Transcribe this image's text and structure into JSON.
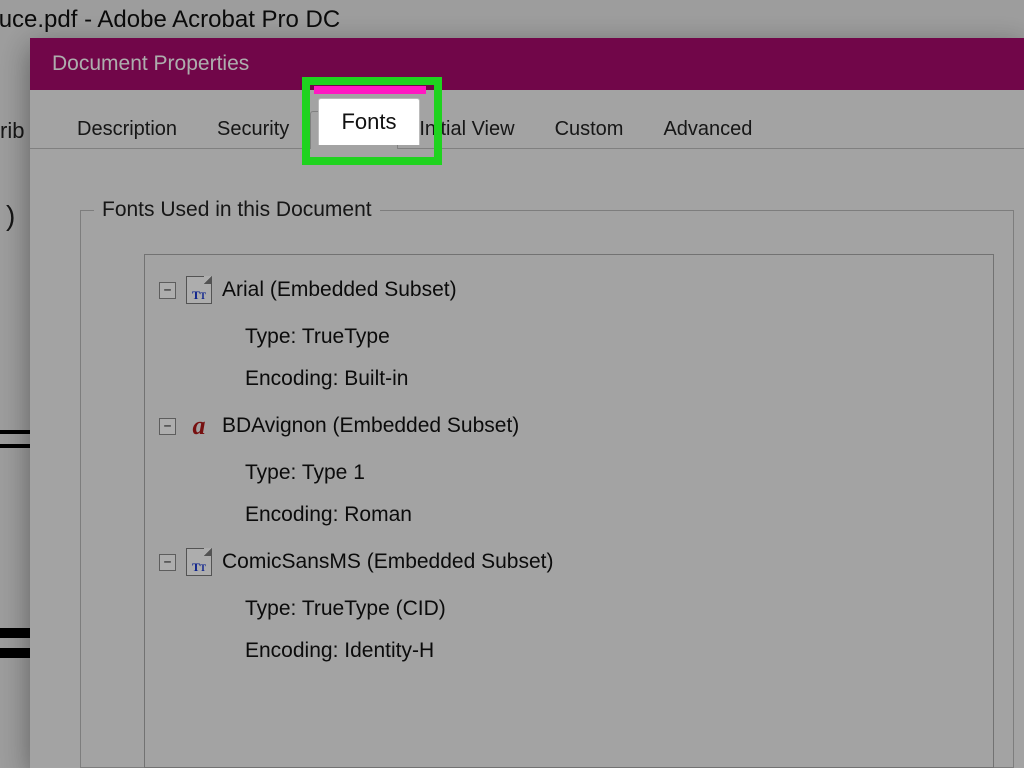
{
  "background": {
    "app_title": "reduce.pdf - Adobe Acrobat Pro DC",
    "gutter_fragment": "rib",
    "paren": ")"
  },
  "dialog": {
    "title": "Document Properties",
    "tabs": {
      "description": "Description",
      "security": "Security",
      "fonts": "Fonts",
      "initial_view": "Initial View",
      "custom": "Custom",
      "advanced": "Advanced"
    },
    "active_tab": "fonts",
    "group_label": "Fonts Used in this Document",
    "type_label": "Type:",
    "encoding_label": "Encoding:",
    "expander_minus": "−",
    "fonts_list": [
      {
        "name": "Arial (Embedded Subset)",
        "icon": "tt",
        "type": "TrueType",
        "encoding": "Built-in"
      },
      {
        "name": "BDAvignon (Embedded Subset)",
        "icon": "a",
        "type": "Type 1",
        "encoding": "Roman"
      },
      {
        "name": "ComicSansMS (Embedded Subset)",
        "icon": "tt",
        "type": "TrueType (CID)",
        "encoding": "Identity-H"
      }
    ]
  }
}
